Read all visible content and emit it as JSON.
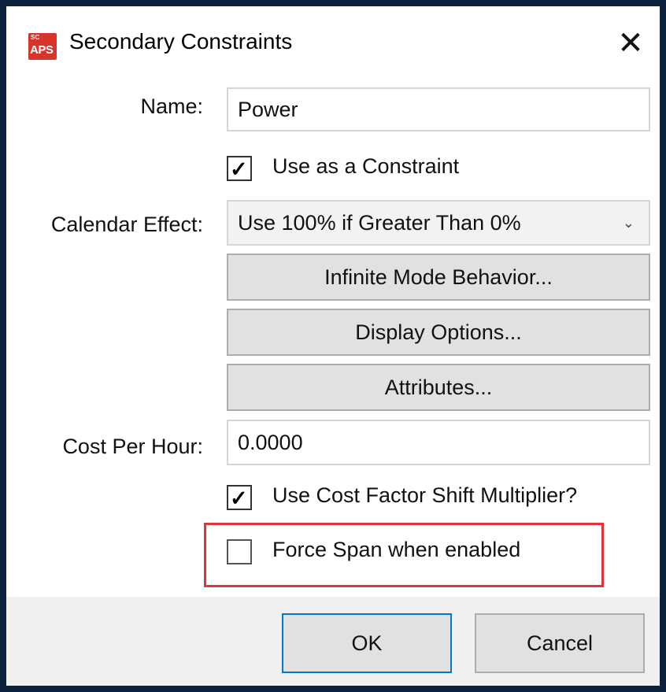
{
  "window": {
    "title": "Secondary Constraints",
    "app_icon_text_small": "SC",
    "app_icon_text": "APS",
    "close_glyph": "✕"
  },
  "form": {
    "name_label": "Name:",
    "name_value": "Power",
    "use_constraint_label": "Use as a Constraint",
    "use_constraint_checked": true,
    "calendar_effect_label": "Calendar Effect:",
    "calendar_effect_value": "Use 100% if Greater Than 0%",
    "infinite_mode_button": "Infinite Mode Behavior...",
    "display_options_button": "Display Options...",
    "attributes_button": "Attributes...",
    "cost_label": "Cost Per Hour:",
    "cost_value": "0.0000",
    "cost_factor_label": "Use Cost Factor Shift Multiplier?",
    "cost_factor_checked": true,
    "force_span_label": "Force Span when enabled",
    "force_span_checked": false
  },
  "footer": {
    "ok_label": "OK",
    "cancel_label": "Cancel"
  },
  "colors": {
    "highlight": "#e2333a",
    "ok_border": "#0078d7",
    "app_icon": "#d9342b"
  },
  "icons": {
    "app": "aps-app-icon",
    "close": "close-icon",
    "dropdown": "chevron-down-icon",
    "check": "checkmark-icon"
  }
}
